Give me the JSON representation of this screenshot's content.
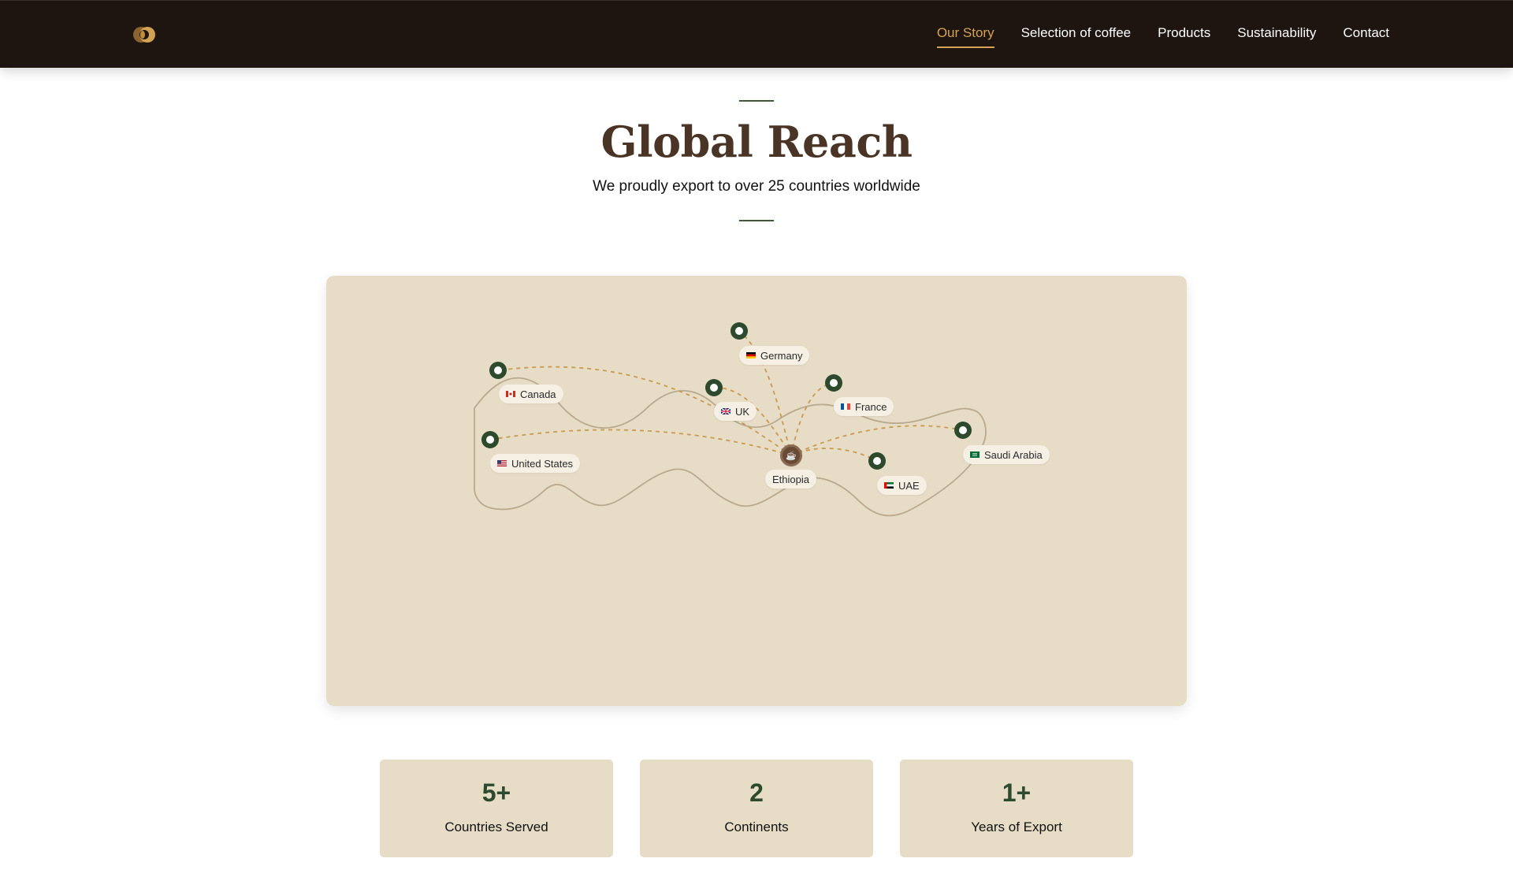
{
  "navbar": {
    "links": [
      "Our Story",
      "Selection of coffee",
      "Products",
      "Sustainability",
      "Contact"
    ],
    "active_index": 0
  },
  "header": {
    "title": "Global Reach",
    "subtitle": "We proudly export to over 25 countries worldwide"
  },
  "map": {
    "hub": {
      "label": "Ethiopia",
      "icon": "coffee-cup-icon"
    },
    "destinations": [
      {
        "name": "Canada",
        "flag": "canada-flag-icon"
      },
      {
        "name": "United States",
        "flag": "us-flag-icon"
      },
      {
        "name": "Germany",
        "flag": "germany-flag-icon"
      },
      {
        "name": "UK",
        "flag": "uk-flag-icon"
      },
      {
        "name": "France",
        "flag": "france-flag-icon"
      },
      {
        "name": "UAE",
        "flag": "uae-flag-icon"
      },
      {
        "name": "Saudi Arabia",
        "flag": "saudi-flag-icon"
      }
    ],
    "colors": {
      "pin": "#2d4a2c",
      "route": "#c99a52",
      "hub": "#6b4a35",
      "outline": "#b8a98f"
    }
  },
  "stats": [
    {
      "value": "5+",
      "label": "Countries Served"
    },
    {
      "value": "2",
      "label": "Continents"
    },
    {
      "value": "1+",
      "label": "Years of Export"
    }
  ],
  "colors": {
    "nav_bg": "#1e1510",
    "accent": "#d4a253",
    "title": "#4a3426",
    "card_bg": "#e7ddc6",
    "green": "#2d4a2c"
  }
}
